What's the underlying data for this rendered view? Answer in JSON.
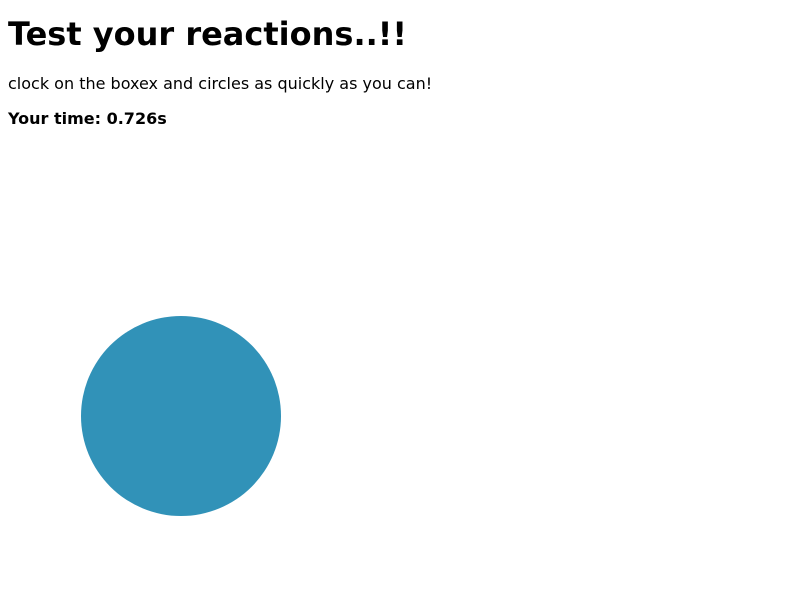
{
  "game": {
    "title": "Test your reactions..!!",
    "instructions": "clock on the boxex and circles as quickly as you can!",
    "time_label": "Your time: ",
    "time_value": "0.726s"
  },
  "target": {
    "shape": "circle",
    "color": "#3192b8"
  }
}
